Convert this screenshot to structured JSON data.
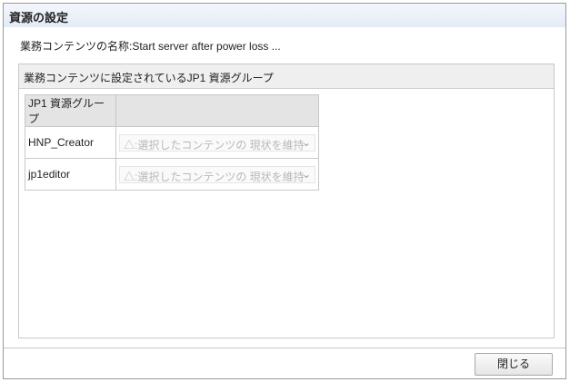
{
  "dialog": {
    "title": "資源の設定",
    "content_name_label": "業務コンテンツの名称:Start server after power loss ...",
    "panel_title": "業務コンテンツに設定されているJP1 資源グループ",
    "table": {
      "headers": [
        "JP1 資源グループ",
        ""
      ],
      "rows": [
        {
          "group": "HNP_Creator",
          "setting": "△:選択したコンテンツの 現状を維持"
        },
        {
          "group": "jp1editor",
          "setting": "△:選択したコンテンツの 現状を維持"
        }
      ]
    },
    "close_label": "閉じる"
  }
}
